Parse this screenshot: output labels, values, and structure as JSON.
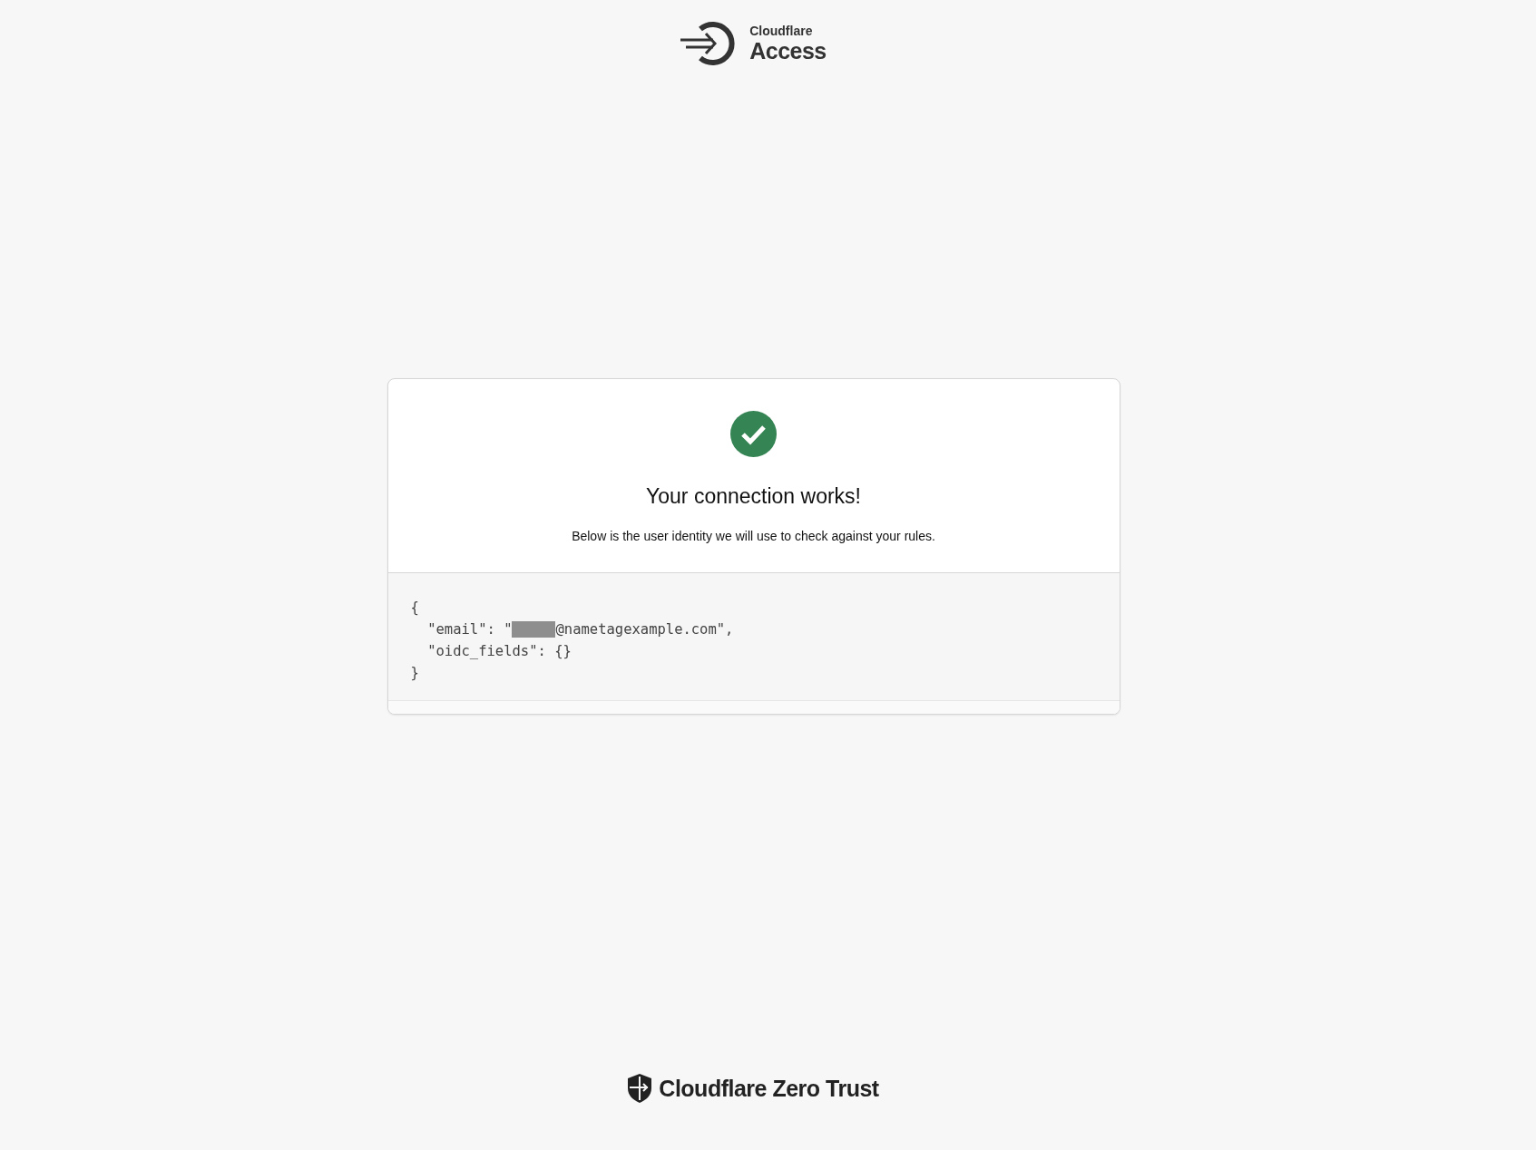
{
  "header": {
    "brand_small": "Cloudflare",
    "brand_large": "Access"
  },
  "card": {
    "success": true,
    "title": "Your connection works!",
    "subtitle": "Below is the user identity we will use to check against your rules.",
    "code_lines": [
      {
        "text": "{"
      },
      {
        "before": "  \"email\": \"",
        "redacted": true,
        "after": "@nametagexample.com\","
      },
      {
        "text": "  \"oidc_fields\": {}"
      },
      {
        "text": "}"
      }
    ]
  },
  "footer": {
    "brand": "Cloudflare Zero Trust"
  }
}
